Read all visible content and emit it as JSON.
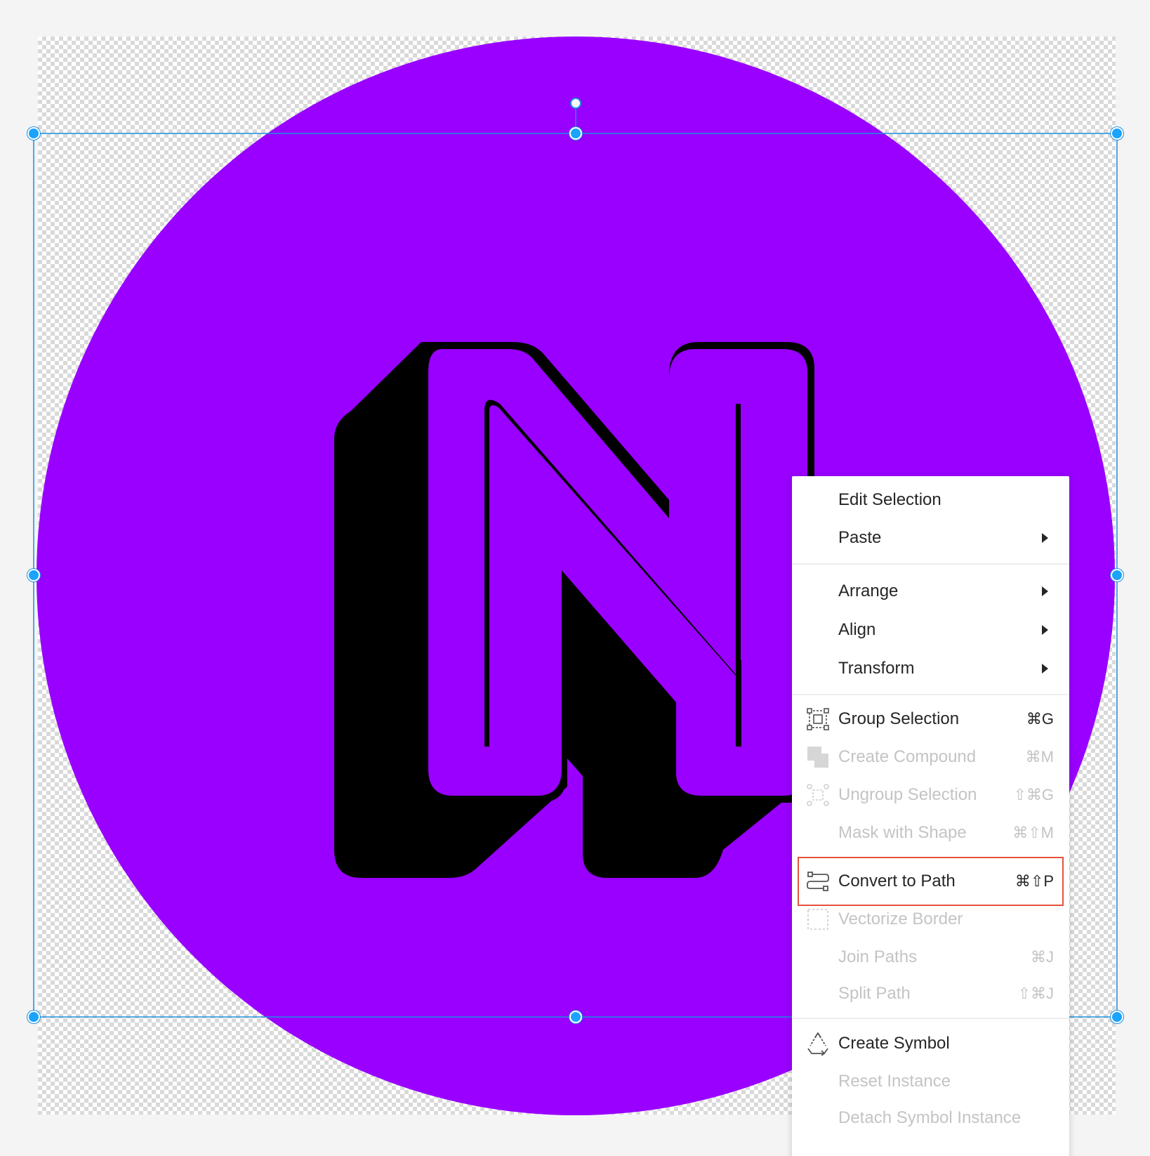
{
  "canvas": {
    "background": "#f4f4f4",
    "circle_color": "#9900ff",
    "letter_color": "#000000",
    "selection_color": "#1a8fe0"
  },
  "context_menu": {
    "items": [
      {
        "label": "Edit Selection",
        "shortcut": "",
        "submenu": false,
        "enabled": true,
        "icon": ""
      },
      {
        "label": "Paste",
        "shortcut": "",
        "submenu": true,
        "enabled": true,
        "icon": ""
      },
      {
        "label": "Arrange",
        "shortcut": "",
        "submenu": true,
        "enabled": true,
        "icon": ""
      },
      {
        "label": "Align",
        "shortcut": "",
        "submenu": true,
        "enabled": true,
        "icon": ""
      },
      {
        "label": "Transform",
        "shortcut": "",
        "submenu": true,
        "enabled": true,
        "icon": ""
      },
      {
        "label": "Group Selection",
        "shortcut": "⌘G",
        "submenu": false,
        "enabled": true,
        "icon": "group-icon"
      },
      {
        "label": "Create Compound",
        "shortcut": "⌘M",
        "submenu": false,
        "enabled": false,
        "icon": "compound-icon"
      },
      {
        "label": "Ungroup Selection",
        "shortcut": "⇧⌘G",
        "submenu": false,
        "enabled": false,
        "icon": "ungroup-icon"
      },
      {
        "label": "Mask with Shape",
        "shortcut": "⌘⇧M",
        "submenu": false,
        "enabled": false,
        "icon": ""
      },
      {
        "label": "Convert to Path",
        "shortcut": "⌘⇧P",
        "submenu": false,
        "enabled": true,
        "icon": "convert-path-icon",
        "highlighted": true
      },
      {
        "label": "Vectorize Border",
        "shortcut": "",
        "submenu": false,
        "enabled": false,
        "icon": "vectorize-border-icon"
      },
      {
        "label": "Join Paths",
        "shortcut": "⌘J",
        "submenu": false,
        "enabled": false,
        "icon": ""
      },
      {
        "label": "Split Path",
        "shortcut": "⇧⌘J",
        "submenu": false,
        "enabled": false,
        "icon": ""
      },
      {
        "label": "Create Symbol",
        "shortcut": "",
        "submenu": false,
        "enabled": true,
        "icon": "create-symbol-icon"
      },
      {
        "label": "Reset Instance",
        "shortcut": "",
        "submenu": false,
        "enabled": false,
        "icon": ""
      },
      {
        "label": "Detach Symbol Instance",
        "shortcut": "",
        "submenu": false,
        "enabled": false,
        "icon": ""
      }
    ],
    "highlight_color": "#e4533a"
  }
}
